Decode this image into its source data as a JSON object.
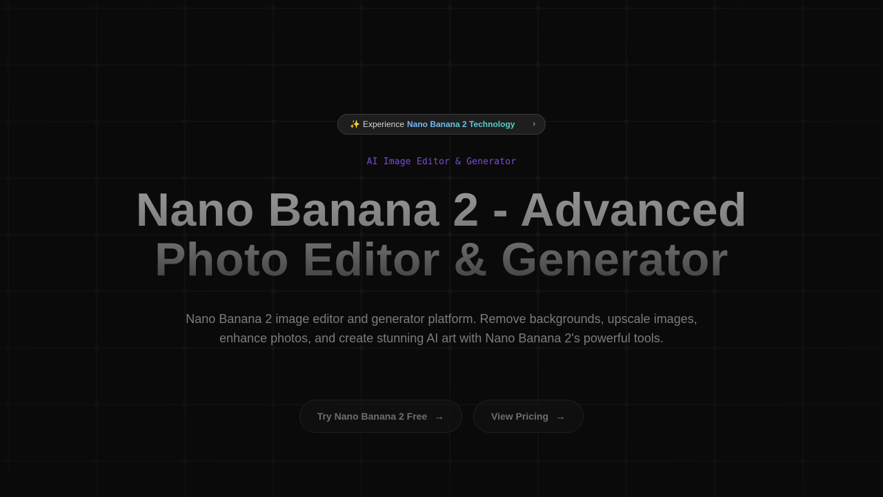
{
  "hero": {
    "announcement": {
      "sparkle_icon": "✨",
      "prefix": "Experience",
      "highlight": "Nano Banana 2 Technology",
      "chevron": "›"
    },
    "eyebrow": "AI Image Editor & Generator",
    "title_line_1": "Nano Banana 2 - Advanced",
    "title_line_2": "Photo Editor & Generator",
    "description": "Nano Banana 2 image editor and generator platform. Remove backgrounds, upscale images, enhance photos, and create stunning AI art with Nano Banana 2's powerful tools.",
    "primary_cta": {
      "label": "Try Nano Banana 2 Free",
      "arrow": "→"
    },
    "secondary_cta": {
      "label": "View Pricing",
      "arrow": "→"
    }
  },
  "colors": {
    "background": "#0a0a0a",
    "eyebrow": "#7a4fd6",
    "highlight_start": "#7fb6ff",
    "highlight_end": "#4ed6c8"
  }
}
